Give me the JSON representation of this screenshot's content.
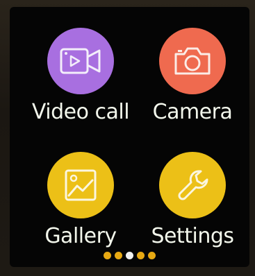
{
  "apps": [
    {
      "id": "video",
      "label": "Video call",
      "icon": "video-camera-icon",
      "color": "#a86fe0"
    },
    {
      "id": "camera",
      "label": "Camera",
      "icon": "photo-camera-icon",
      "color": "#ef6a4f"
    },
    {
      "id": "gallery",
      "label": "Gallery",
      "icon": "image-icon",
      "color": "#ecc017"
    },
    {
      "id": "settings",
      "label": "Settings",
      "icon": "wrench-icon",
      "color": "#ecc017"
    }
  ],
  "pager": {
    "count": 5,
    "active_index": 2,
    "dot_color": "#e7a913",
    "active_color": "#f2f2f2"
  }
}
